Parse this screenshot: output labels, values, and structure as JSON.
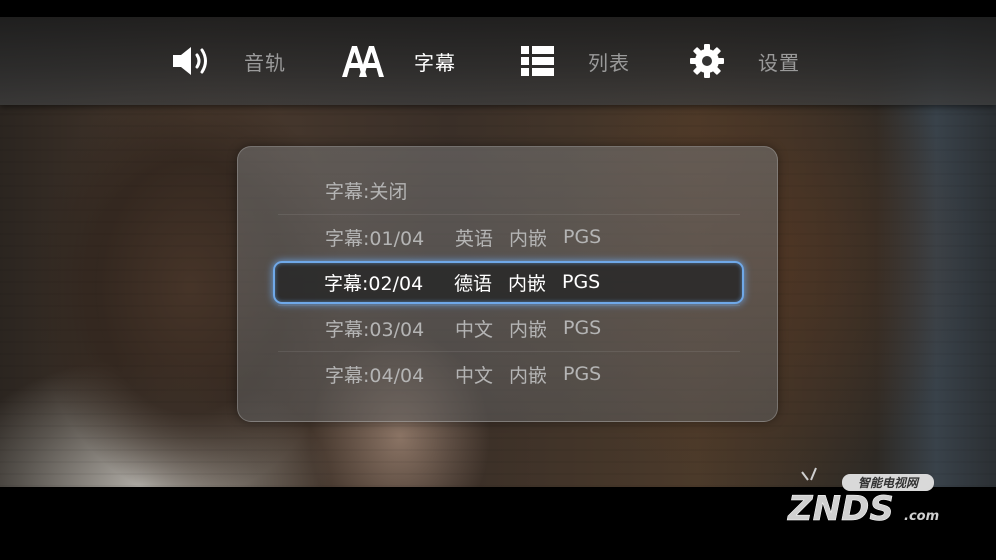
{
  "menu": {
    "items": [
      {
        "label": "音轨",
        "icon": "speaker-icon",
        "active": false
      },
      {
        "label": "字幕",
        "icon": "subtitle-aa-icon",
        "active": true
      },
      {
        "label": "列表",
        "icon": "list-icon",
        "active": false
      },
      {
        "label": "设置",
        "icon": "gear-icon",
        "active": false
      }
    ]
  },
  "subtitles": {
    "off_label": "字幕:关闭",
    "tracks": [
      {
        "track": "字幕:01/04",
        "lang": "英语",
        "type": "内嵌",
        "format": "PGS"
      },
      {
        "track": "字幕:02/04",
        "lang": "德语",
        "type": "内嵌",
        "format": "PGS"
      },
      {
        "track": "字幕:03/04",
        "lang": "中文",
        "type": "内嵌",
        "format": "PGS"
      },
      {
        "track": "字幕:04/04",
        "lang": "中文",
        "type": "内嵌",
        "format": "PGS"
      }
    ],
    "selected_index": 1
  },
  "watermark": {
    "tagline": "智能电视网",
    "brand": "ZNDS",
    "suffix": ".com"
  },
  "colors": {
    "accent": "#6fa8e8",
    "text_active": "#ffffff",
    "text_inactive": "#9a9a9a"
  }
}
